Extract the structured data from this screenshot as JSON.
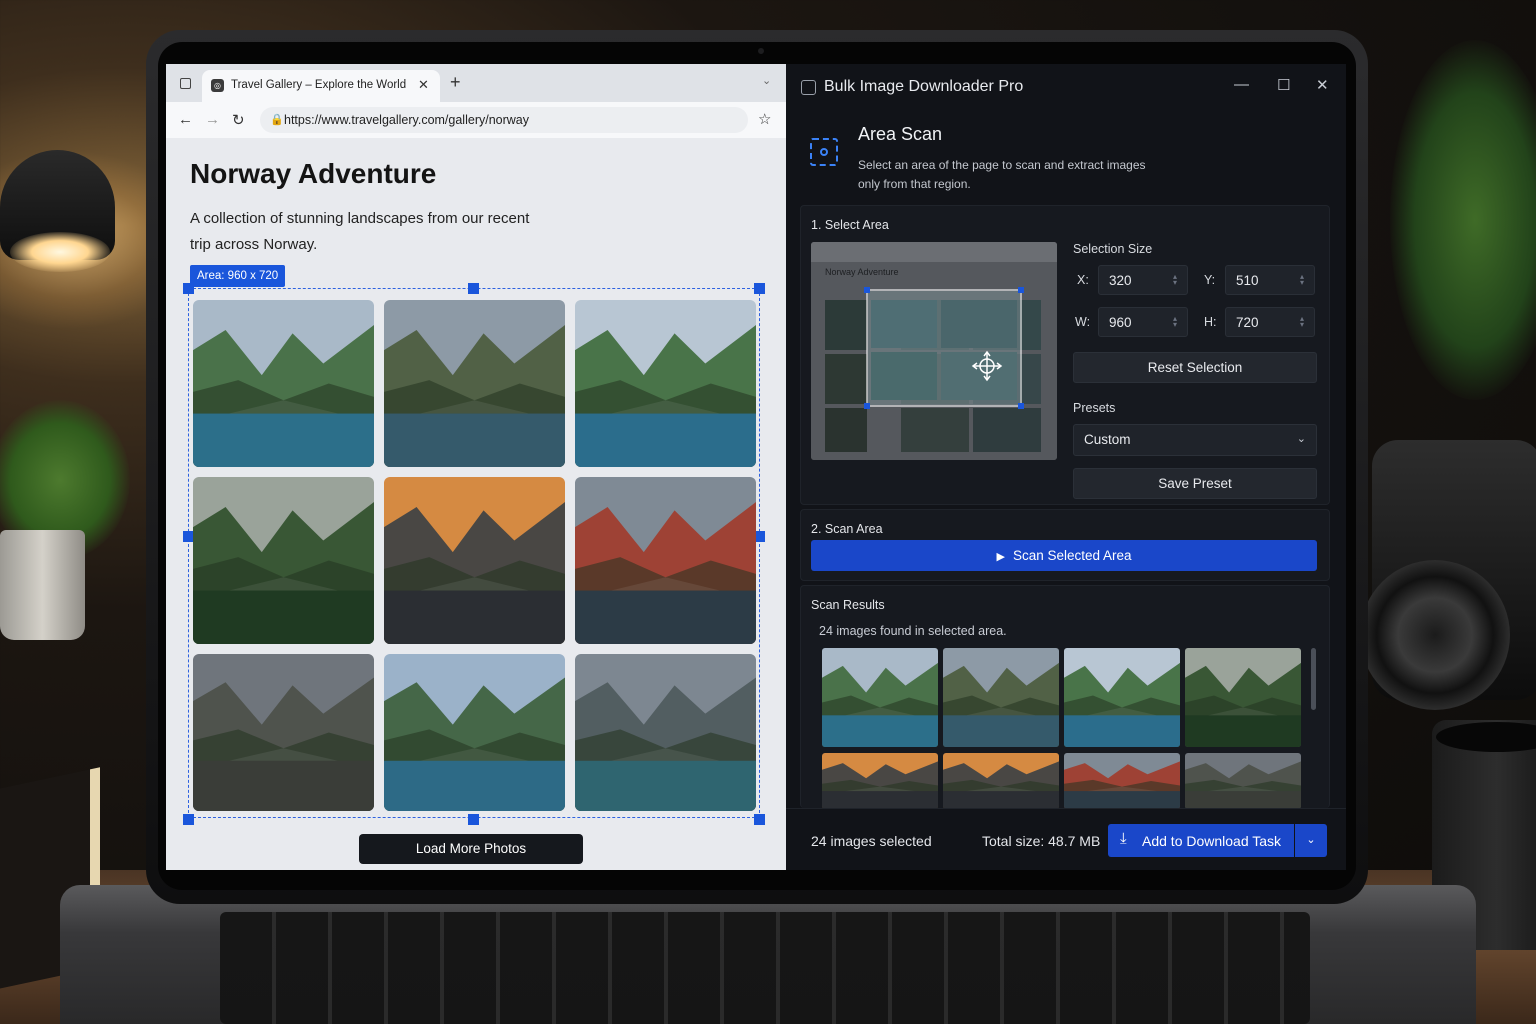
{
  "browser": {
    "tab_title": "Travel Gallery – Explore the World",
    "tab_close": "✕",
    "new_tab": "+",
    "tab_menu": "⌄",
    "url": "https://www.travelgallery.com/gallery/norway",
    "nav": {
      "back": "←",
      "forward": "→",
      "reload": "↻",
      "lock": "🔒",
      "bookmark": "☆"
    }
  },
  "page": {
    "title": "Norway Adventure",
    "description": "A collection of stunning landscapes from our recent trip across Norway.",
    "area_tag": "Area: 960 x 720",
    "load_more": "Load More Photos",
    "photos": [
      {
        "scene": "fjord",
        "sky": "#a9b9c8",
        "mid": "#3f6a3c",
        "low": "#2c6f8a"
      },
      {
        "scene": "village",
        "sky": "#8d9aa6",
        "mid": "#4a5b3c",
        "low": "#355a6b"
      },
      {
        "scene": "peaks-lake",
        "sky": "#b8c6d3",
        "mid": "#3d6a3a",
        "low": "#2b6d8c"
      },
      {
        "scene": "waterfall",
        "sky": "#9aa39a",
        "mid": "#2f4f2a",
        "low": "#1f3a22"
      },
      {
        "scene": "sunset",
        "sky": "#d58a42",
        "mid": "#3a3f45",
        "low": "#2b2e33"
      },
      {
        "scene": "houses",
        "sky": "#7f8a95",
        "mid": "#a23a2a",
        "low": "#2c3b46"
      },
      {
        "scene": "hiker",
        "sky": "#6f757c",
        "mid": "#4b5048",
        "low": "#3a3d38"
      },
      {
        "scene": "lake",
        "sky": "#9bb2c9",
        "mid": "#3c5e3a",
        "low": "#2d6a86"
      },
      {
        "scene": "glacier",
        "sky": "#7d8791",
        "mid": "#4e5a5c",
        "low": "#2f6570"
      }
    ]
  },
  "app": {
    "title": "Bulk Image Downloader Pro",
    "controls": {
      "minimize": "—",
      "maximize": "☐",
      "close": "✕"
    },
    "header": {
      "title": "Area Scan",
      "description": "Select an area of the page to scan and extract images only from that region."
    },
    "select_area": {
      "label": "1. Select Area",
      "preview_title": "Norway Adventure",
      "selection_size_label": "Selection Size",
      "x_label": "X:",
      "x": "320",
      "y_label": "Y:",
      "y": "510",
      "w_label": "W:",
      "w": "960",
      "h_label": "H:",
      "h": "720",
      "reset": "Reset Selection",
      "presets_label": "Presets",
      "preset_value": "Custom",
      "save_preset": "Save Preset"
    },
    "scan_area": {
      "label": "2. Scan Area",
      "button": "Scan Selected Area",
      "button_icon": "▶"
    },
    "results": {
      "label": "Scan Results",
      "count_text": "24 images found in selected area."
    },
    "footer": {
      "selected": "24 images selected",
      "total": "Total size: 48.7 MB",
      "download": "Add to Download Task",
      "download_icon": "⤓",
      "caret": "⌄"
    }
  }
}
